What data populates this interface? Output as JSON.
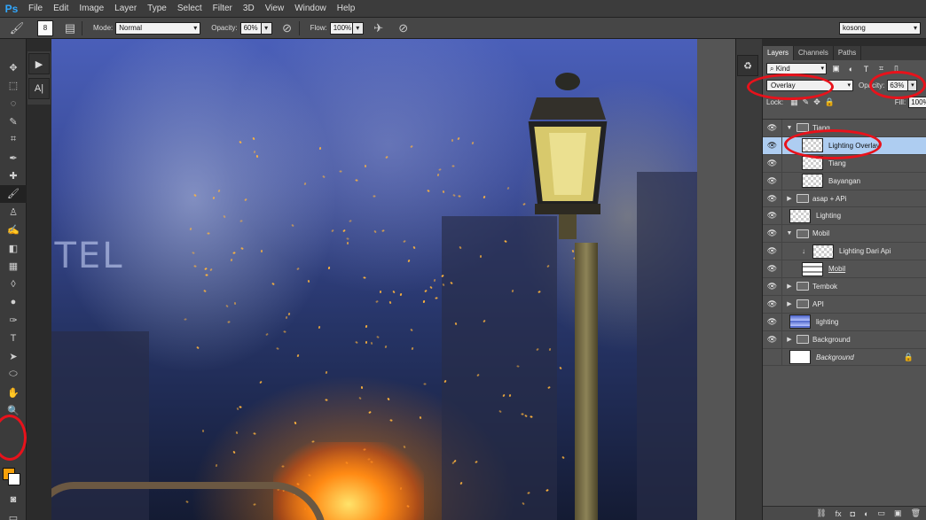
{
  "app": {
    "logo": "Ps"
  },
  "menu": [
    "File",
    "Edit",
    "Image",
    "Layer",
    "Type",
    "Select",
    "Filter",
    "3D",
    "View",
    "Window",
    "Help"
  ],
  "options": {
    "brush_size": "8",
    "mode_label": "Mode:",
    "mode_value": "Normal",
    "opacity_label": "Opacity:",
    "opacity_value": "60%",
    "flow_label": "Flow:",
    "flow_value": "100%",
    "workspace": "kosong"
  },
  "tools": [
    "move-tool",
    "marquee-tool",
    "lasso-tool",
    "quick-select-tool",
    "crop-tool",
    "eyedropper-tool",
    "healing-brush-tool",
    "brush-tool",
    "clone-stamp-tool",
    "history-brush-tool",
    "eraser-tool",
    "gradient-tool",
    "blur-tool",
    "dodge-tool",
    "pen-tool",
    "type-tool",
    "path-selection-tool",
    "shape-tool",
    "hand-tool",
    "zoom-tool"
  ],
  "tool_glyphs": [
    "✥",
    "⬚",
    "◌",
    "✎",
    "⌗",
    "✒",
    "✚",
    "🖌",
    "♙",
    "✍",
    "◧",
    "▦",
    "◊",
    "●",
    "✑",
    "T",
    "➤",
    "⬭",
    "✋",
    "🔍"
  ],
  "colors": {
    "foreground": "#f7a10a",
    "background": "#ffffff",
    "annotation": "#e8121b",
    "selection": "#aecdf1"
  },
  "canvas": {
    "sign_text": "OTEL"
  },
  "layers_panel": {
    "tabs": [
      "Layers",
      "Channels",
      "Paths"
    ],
    "kind_label": "Kind",
    "blend_mode": "Overlay",
    "opacity_label": "Opacity:",
    "opacity_value": "63%",
    "lock_label": "Lock:",
    "fill_label": "Fill:",
    "fill_value": "100%",
    "layers": [
      {
        "name": "Tiang",
        "type": "group",
        "expanded": true,
        "visible": true,
        "indent": 0
      },
      {
        "name": "Lighting Overlay",
        "type": "layer",
        "visible": true,
        "selected": true,
        "indent": 1
      },
      {
        "name": "Tiang",
        "type": "layer",
        "visible": true,
        "indent": 1
      },
      {
        "name": "Bayangan",
        "type": "layer",
        "visible": true,
        "indent": 1
      },
      {
        "name": "asap + APi",
        "type": "group",
        "expanded": false,
        "visible": true,
        "indent": 0
      },
      {
        "name": "Lighting",
        "type": "layer",
        "visible": true,
        "indent": 0
      },
      {
        "name": "Mobil",
        "type": "group",
        "expanded": true,
        "visible": true,
        "indent": 0
      },
      {
        "name": "Lighting Dari Api",
        "type": "layer",
        "visible": true,
        "indent": 1,
        "clipped": true
      },
      {
        "name": "Mobil",
        "type": "layer",
        "visible": true,
        "indent": 1,
        "thumb": "car",
        "underline": true
      },
      {
        "name": "Tembok",
        "type": "group",
        "expanded": false,
        "visible": true,
        "indent": 0
      },
      {
        "name": "API",
        "type": "group",
        "expanded": false,
        "visible": true,
        "indent": 0
      },
      {
        "name": "lighting",
        "type": "layer",
        "visible": true,
        "indent": 0,
        "thumb": "blue"
      },
      {
        "name": "Background",
        "type": "group",
        "expanded": false,
        "visible": true,
        "indent": 0
      },
      {
        "name": "Background",
        "type": "layer",
        "visible": false,
        "indent": 0,
        "thumb": "solid",
        "italic": true,
        "locked": true
      }
    ],
    "footer_buttons": [
      "link-icon",
      "fx-icon",
      "mask-icon",
      "adjustment-icon",
      "new-group-icon",
      "new-layer-icon",
      "trash-icon"
    ],
    "footer_glyphs": [
      "⛓",
      "fx",
      "◘",
      "◐",
      "▭",
      "▣",
      "🗑"
    ]
  }
}
